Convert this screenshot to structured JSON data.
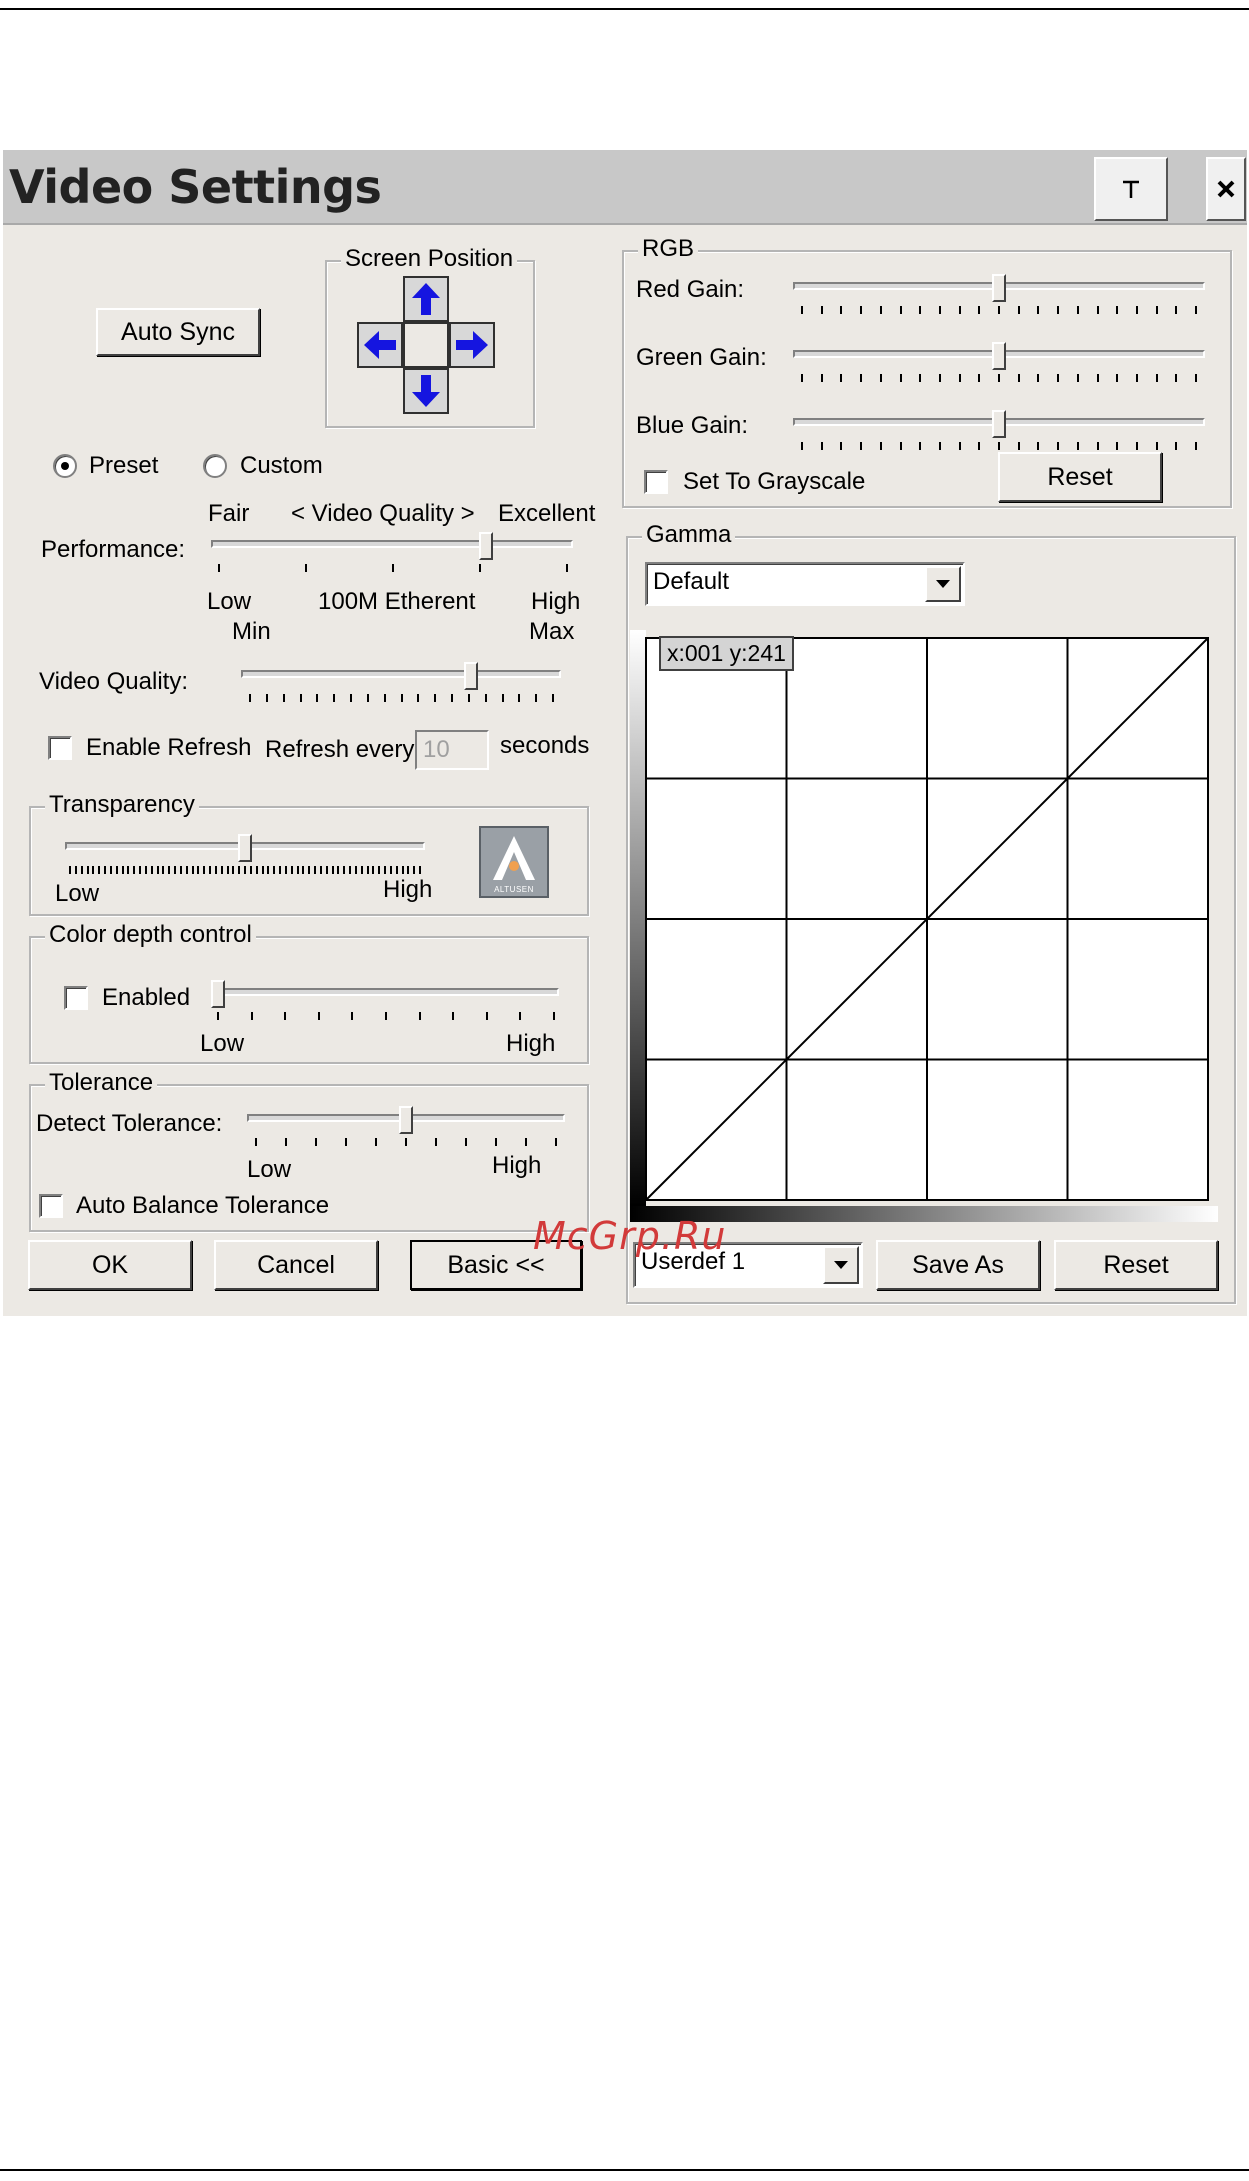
{
  "window": {
    "title": "Video Settings",
    "pin_icon": "pin-icon",
    "close_icon": "close-icon"
  },
  "buttons": {
    "auto_sync": "Auto Sync",
    "rgb_reset": "Reset",
    "ok": "OK",
    "cancel": "Cancel",
    "basic": "Basic <<",
    "save_as": "Save As",
    "gamma_reset": "Reset"
  },
  "screen_position": {
    "legend": "Screen Position",
    "icons": [
      "arrow-up-icon",
      "arrow-left-icon",
      "arrow-right-icon",
      "arrow-down-icon"
    ]
  },
  "mode": {
    "preset": "Preset",
    "custom": "Custom",
    "selected": "Preset"
  },
  "performance": {
    "label": "Performance:",
    "top_left": "Fair",
    "top_center": "< Video Quality >",
    "top_right": "Excellent",
    "bottom_left": "Low",
    "bottom_center": "100M Etherent",
    "bottom_right": "High",
    "value": 0.77
  },
  "video_quality": {
    "label": "Video Quality:",
    "min": "Min",
    "max": "Max",
    "value": 0.73
  },
  "refresh": {
    "enable_label": "Enable Refresh",
    "every_label": "Refresh every",
    "value": "10",
    "unit": "seconds",
    "enabled": false
  },
  "transparency": {
    "legend": "Transparency",
    "low": "Low",
    "high": "High",
    "value": 0.5
  },
  "logo": {
    "text": "ALTUSEN",
    "icon": "altusen-logo"
  },
  "color_depth": {
    "legend": "Color depth control",
    "enabled_label": "Enabled",
    "low": "Low",
    "high": "High",
    "value": 0.0,
    "enabled": false
  },
  "tolerance": {
    "legend": "Tolerance",
    "detect_label": "Detect Tolerance:",
    "low": "Low",
    "high": "High",
    "auto_balance": "Auto Balance Tolerance",
    "value": 0.5
  },
  "rgb": {
    "legend": "RGB",
    "red_label": "Red Gain:",
    "green_label": "Green Gain:",
    "blue_label": "Blue Gain:",
    "red": 0.5,
    "green": 0.5,
    "blue": 0.5,
    "grayscale_label": "Set To Grayscale",
    "grayscale": false
  },
  "gamma": {
    "legend": "Gamma",
    "selected": "Default",
    "coords": "x:001 y:241",
    "preset": "Userdef 1"
  },
  "watermark": "McGrp.Ru",
  "colors": {
    "dialog_bg": "#ece9e4",
    "title_bg": "#c8c8c8",
    "arrow_blue": "#1515e0",
    "logo_bg": "#9aa0a6",
    "logo_accent": "#f0a050",
    "watermark": "#d23a3a"
  }
}
